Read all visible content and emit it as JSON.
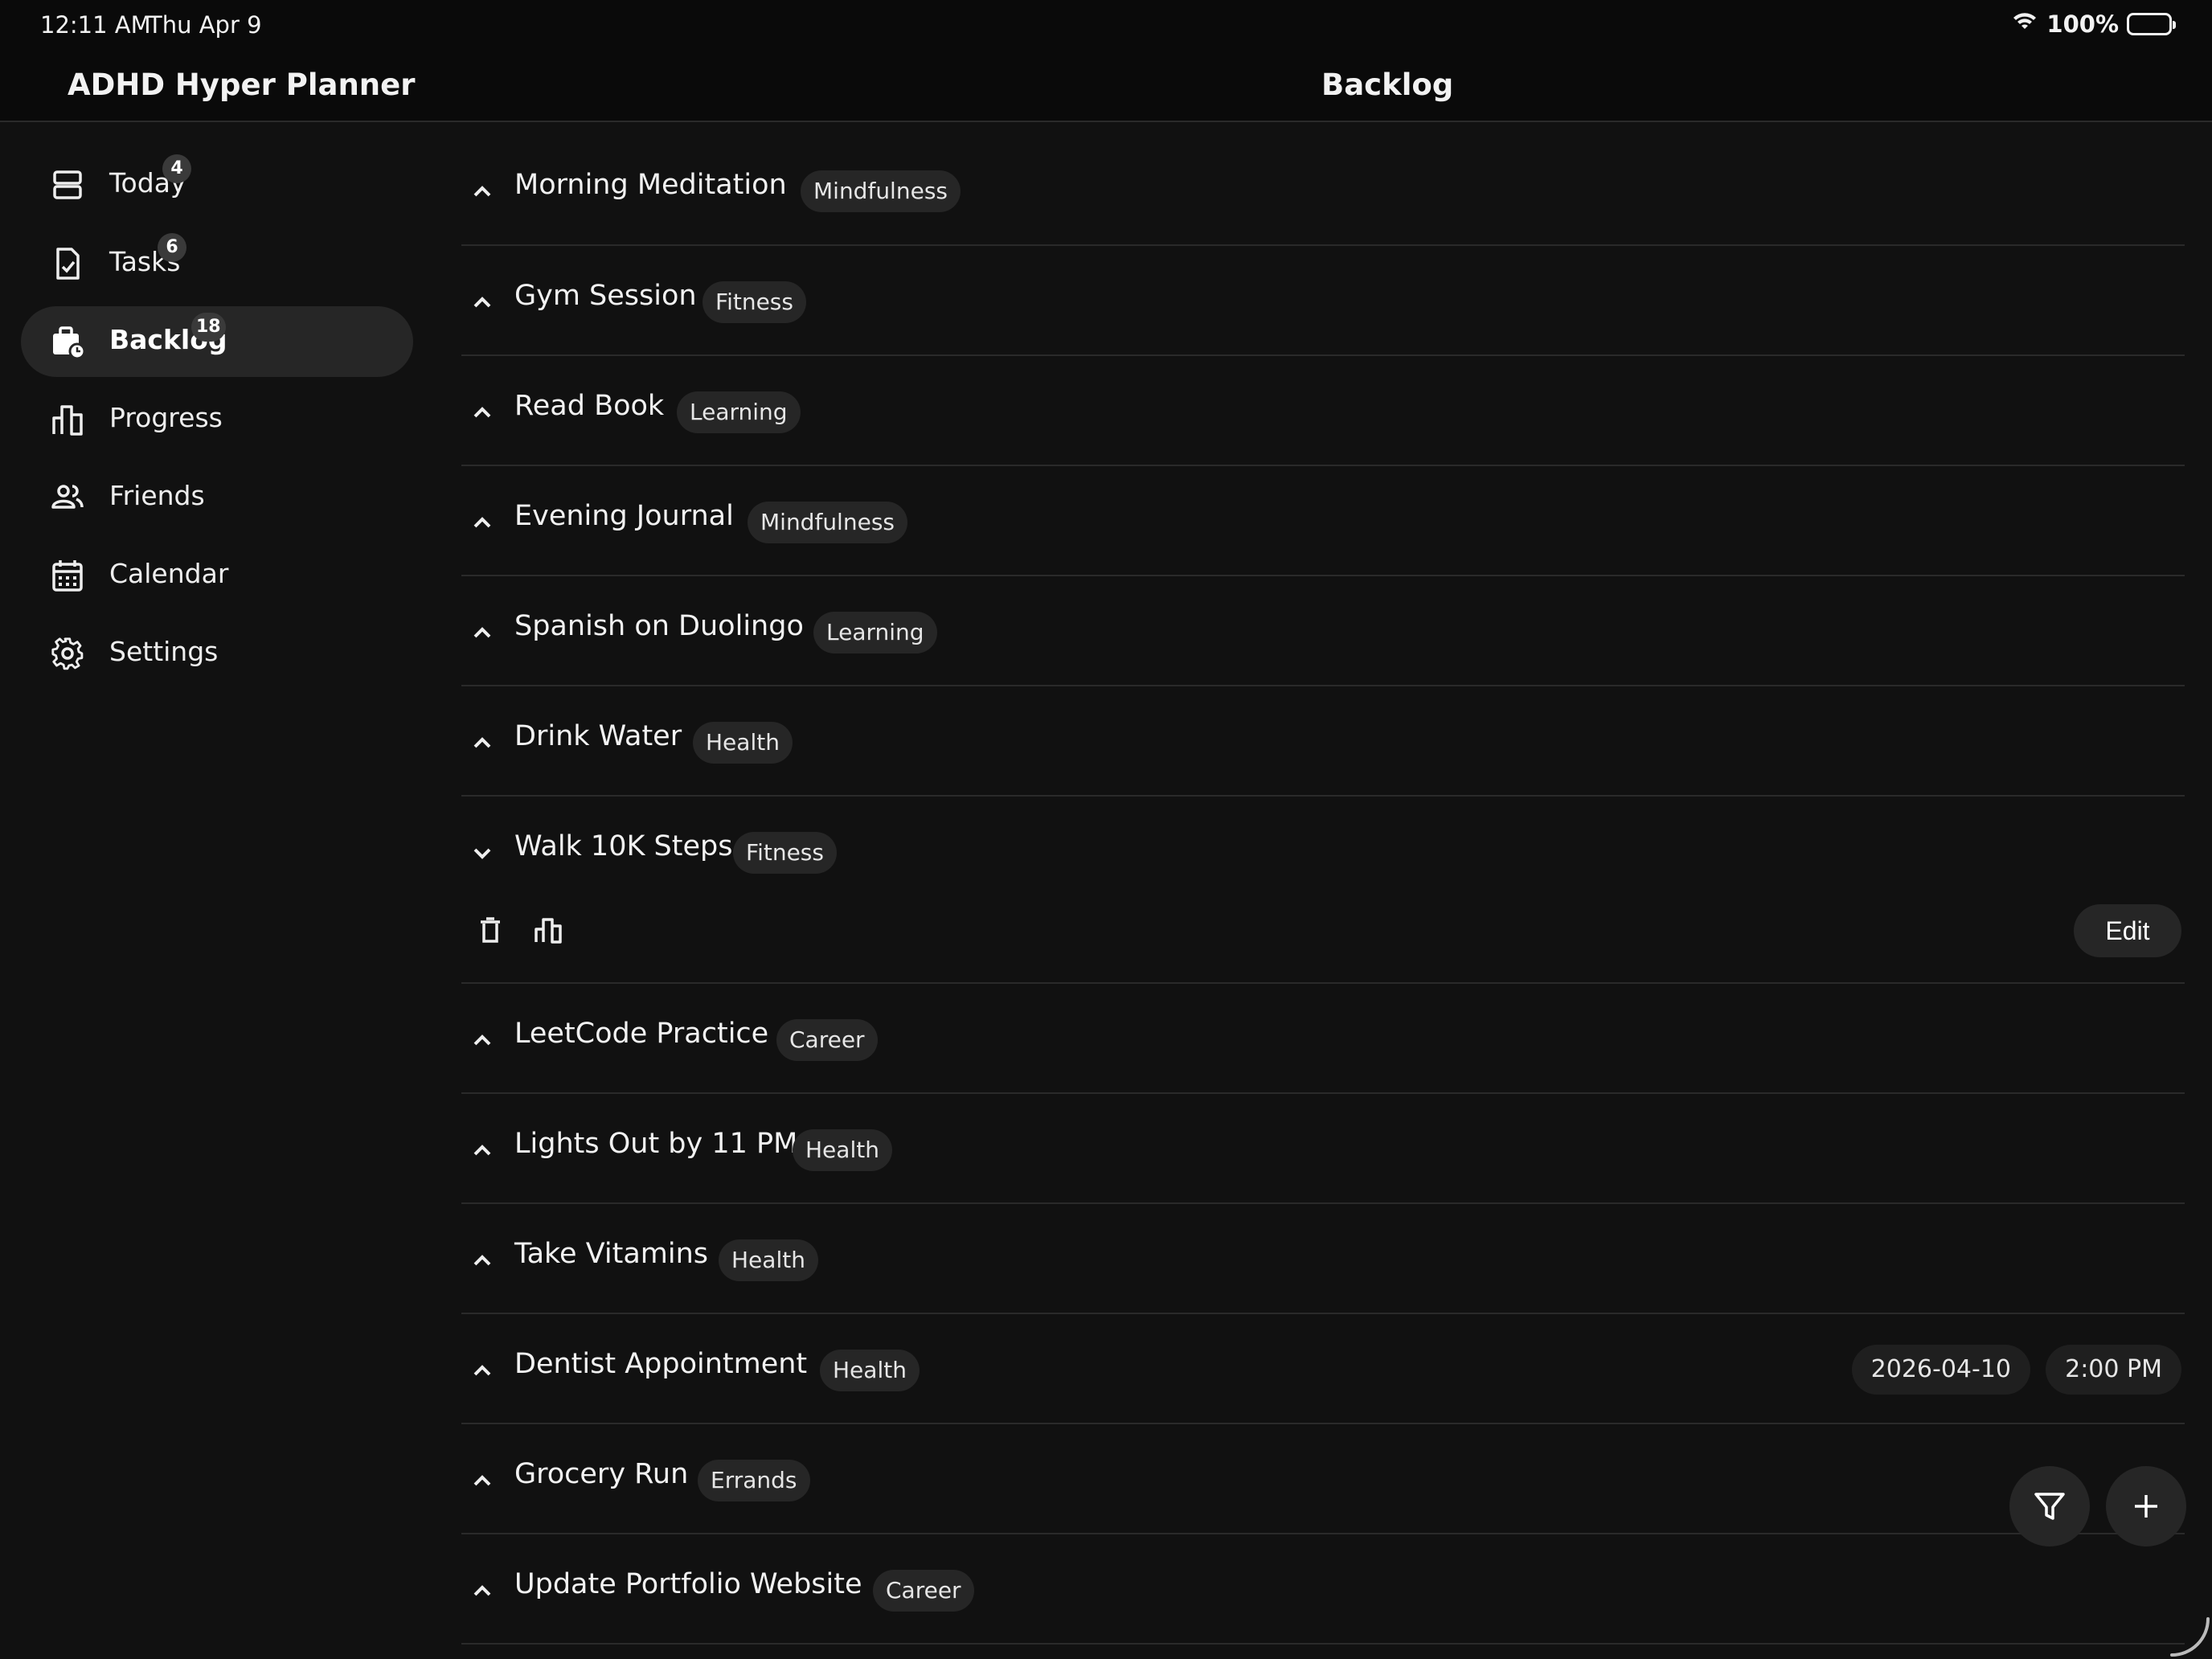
{
  "status_bar": {
    "time": "12:11 AM",
    "date": "Thu Apr 9",
    "battery": "100%"
  },
  "header": {
    "app_title": "ADHD Hyper Planner",
    "page_title": "Backlog"
  },
  "sidebar": {
    "items": [
      {
        "label": "Today",
        "badge": "4",
        "icon": "today-icon"
      },
      {
        "label": "Tasks",
        "badge": "6",
        "icon": "tasks-icon"
      },
      {
        "label": "Backlog",
        "badge": "18",
        "icon": "backlog-icon",
        "active": true
      },
      {
        "label": "Progress",
        "icon": "progress-icon"
      },
      {
        "label": "Friends",
        "icon": "friends-icon"
      },
      {
        "label": "Calendar",
        "icon": "calendar-icon"
      },
      {
        "label": "Settings",
        "icon": "gear-icon"
      }
    ]
  },
  "tasks": [
    {
      "title": "Morning Meditation",
      "tag": "Mindfulness"
    },
    {
      "title": "Gym Session",
      "tag": "Fitness"
    },
    {
      "title": "Read Book",
      "tag": "Learning"
    },
    {
      "title": "Evening Journal",
      "tag": "Mindfulness"
    },
    {
      "title": "Spanish on Duolingo",
      "tag": "Learning"
    },
    {
      "title": "Drink Water",
      "tag": "Health"
    },
    {
      "title": "Walk 10K Steps",
      "tag": "Fitness",
      "expanded": true,
      "edit_label": "Edit"
    },
    {
      "title": "LeetCode Practice",
      "tag": "Career"
    },
    {
      "title": "Lights Out by 11 PM",
      "tag": "Health"
    },
    {
      "title": "Take Vitamins",
      "tag": "Health"
    },
    {
      "title": "Dentist Appointment",
      "tag": "Health",
      "date": "2026-04-10",
      "time": "2:00 PM"
    },
    {
      "title": "Grocery Run",
      "tag": "Errands"
    },
    {
      "title": "Update Portfolio Website",
      "tag": "Career"
    }
  ],
  "colors": {
    "background": "#111111",
    "surface": "#262626",
    "divider": "#2a2a2a",
    "text": "#f2f2f2"
  },
  "fab": {
    "filter_icon": "filter-icon",
    "add_icon": "plus-icon"
  }
}
